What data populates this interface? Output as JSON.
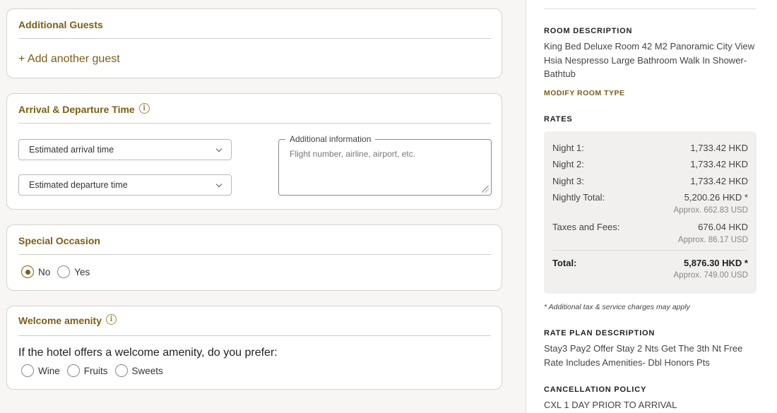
{
  "additional_guests": {
    "title": "Additional Guests",
    "add_label": "+ Add another guest"
  },
  "arrival": {
    "title": "Arrival & Departure Time",
    "arrival_placeholder": "Estimated arrival time",
    "departure_placeholder": "Estimated departure time",
    "info_legend": "Additional information",
    "info_placeholder": "Flight number, airline, airport, etc."
  },
  "special_occasion": {
    "title": "Special Occasion",
    "options": [
      "No",
      "Yes"
    ],
    "selected": "No"
  },
  "welcome": {
    "title": "Welcome amenity",
    "question": "If the hotel offers a welcome amenity, do you prefer:",
    "options": [
      "Wine",
      "Fruits",
      "Sweets"
    ]
  },
  "sidebar": {
    "room_heading": "ROOM DESCRIPTION",
    "room_text": "King Bed Deluxe Room 42 M2 Panoramic City View Hsia Nespresso Large Bathroom Walk In Shower-Bathtub",
    "modify_link": "MODIFY ROOM TYPE",
    "rates_heading": "RATES",
    "rates": {
      "night1_label": "Night 1:",
      "night1_value": "1,733.42 HKD",
      "night2_label": "Night 2:",
      "night2_value": "1,733.42 HKD",
      "night3_label": "Night 3:",
      "night3_value": "1,733.42 HKD",
      "nightly_label": "Nightly Total:",
      "nightly_value": "5,200.26 HKD *",
      "nightly_usd": "Approx. 662.83 USD",
      "taxes_label": "Taxes and Fees:",
      "taxes_value": "676.04 HKD",
      "taxes_usd": "Approx. 86.17 USD",
      "total_label": "Total:",
      "total_value": "5,876.30 HKD *",
      "total_usd": "Approx. 749.00 USD"
    },
    "note": "* Additional tax & service charges may apply",
    "rate_plan_heading": "RATE PLAN DESCRIPTION",
    "rate_plan_text": "Stay3 Pay2 Offer Stay 2 Nts Get The 3th Nt Free Rate Includes Amenities- Dbl Honors Pts",
    "cancel_heading": "CANCELLATION POLICY",
    "cancel_text": "CXL 1 DAY PRIOR TO ARRIVAL"
  },
  "colors": {
    "accent": "#7a5f14",
    "panel_bg": "#f1f0ee"
  }
}
